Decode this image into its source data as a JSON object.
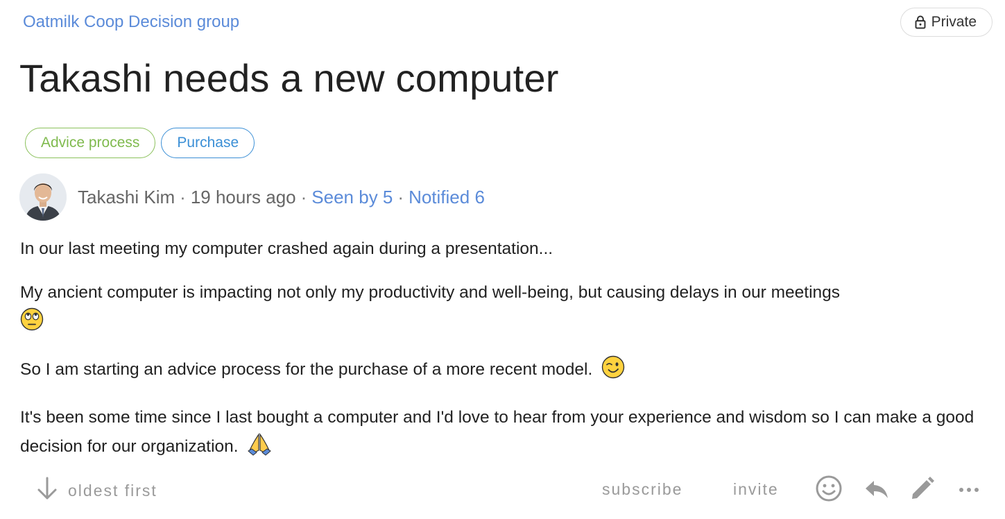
{
  "header": {
    "group_name": "Oatmilk Coop Decision group",
    "privacy_label": "Private",
    "privacy_icon": "lock-icon"
  },
  "thread": {
    "title": "Takashi needs a new computer",
    "tags": [
      {
        "label": "Advice process",
        "color": "#7fba4e"
      },
      {
        "label": "Purchase",
        "color": "#3b8fd6"
      }
    ],
    "author": {
      "name": "Takashi Kim",
      "time": "19 hours ago",
      "seen_by": "Seen by 5",
      "notified": "Notified 6",
      "separator": "·"
    },
    "paragraphs": [
      {
        "text": "In our last meeting my computer crashed again during a presentation...",
        "emoji": ""
      },
      {
        "text": "My ancient computer is impacting not only my productivity and well-being, but causing delays in our meetings",
        "emoji": "face-with-rolling-eyes-emoji"
      },
      {
        "text": "So I am starting an advice process for the purchase of a more recent model.",
        "emoji": "winking-face-emoji"
      },
      {
        "text": "It's been some time since I last bought a computer and I'd love to hear from your experience and wisdom so I can make a good decision for our organization.",
        "emoji": "folded-hands-emoji"
      }
    ]
  },
  "actions": {
    "sort_label": "oldest first",
    "sort_icon": "arrow-down-icon",
    "subscribe_label": "subscribe",
    "invite_label": "invite",
    "icons": [
      "smiley-icon",
      "reply-icon",
      "edit-icon",
      "more-icon"
    ]
  },
  "colors": {
    "link": "#5b8bd9",
    "text": "#222222",
    "muted": "#9a9a9a"
  }
}
